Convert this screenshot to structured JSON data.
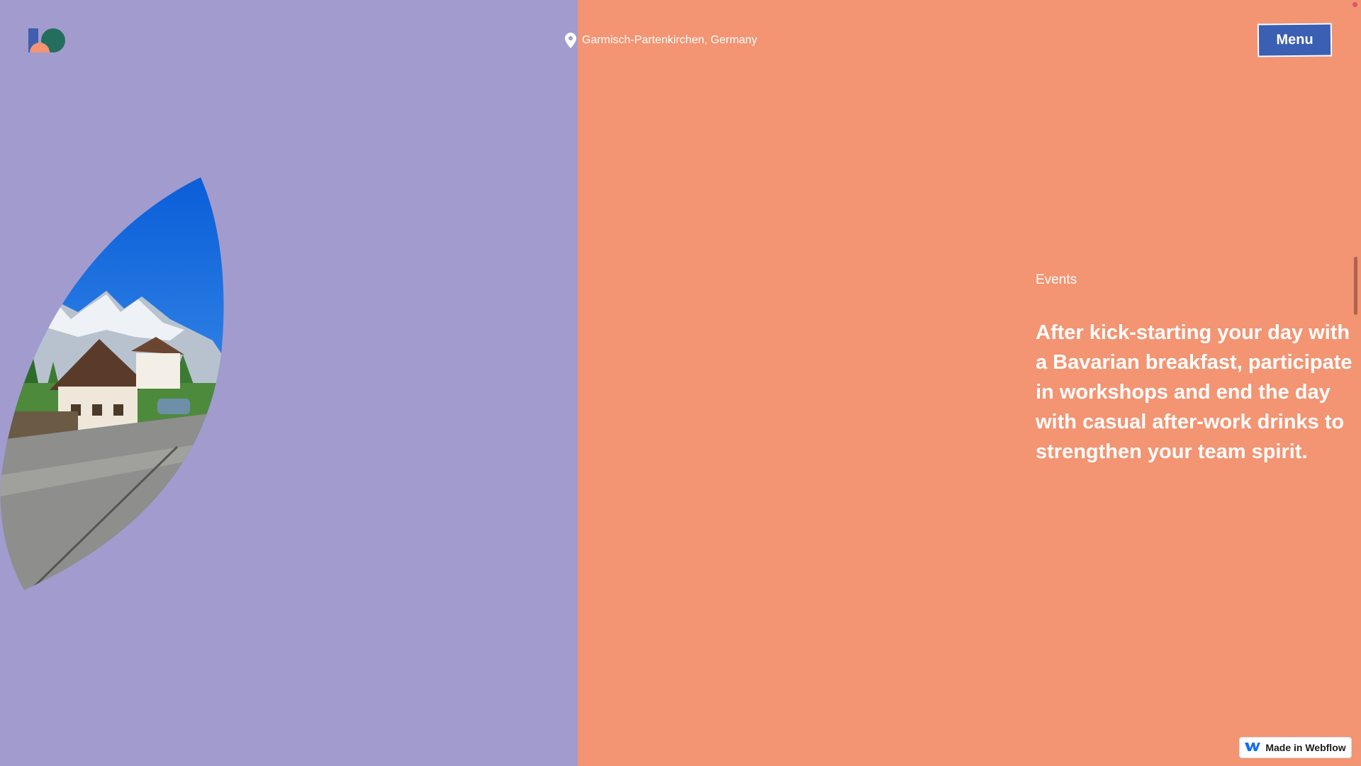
{
  "header": {
    "logo_icon": "brand-logo-icon",
    "location_icon": "map-pin-icon",
    "location_text": "Garmisch-Partenkirchen, Germany",
    "menu_label": "Menu"
  },
  "hero": {
    "image_description_icon": "alpine-village-photo",
    "section_label": "Events",
    "headline": "After kick-starting your day with a Bavarian breakfast, participate in workshops and end the day with casual after-work drinks to strengthen your team spirit."
  },
  "badge": {
    "icon": "webflow-logo-icon",
    "label": "Made in Webflow"
  },
  "colors": {
    "left_panel": "#a29bce",
    "right_panel": "#f39472",
    "menu_button": "#3a5fb3",
    "text": "#ffffff"
  }
}
